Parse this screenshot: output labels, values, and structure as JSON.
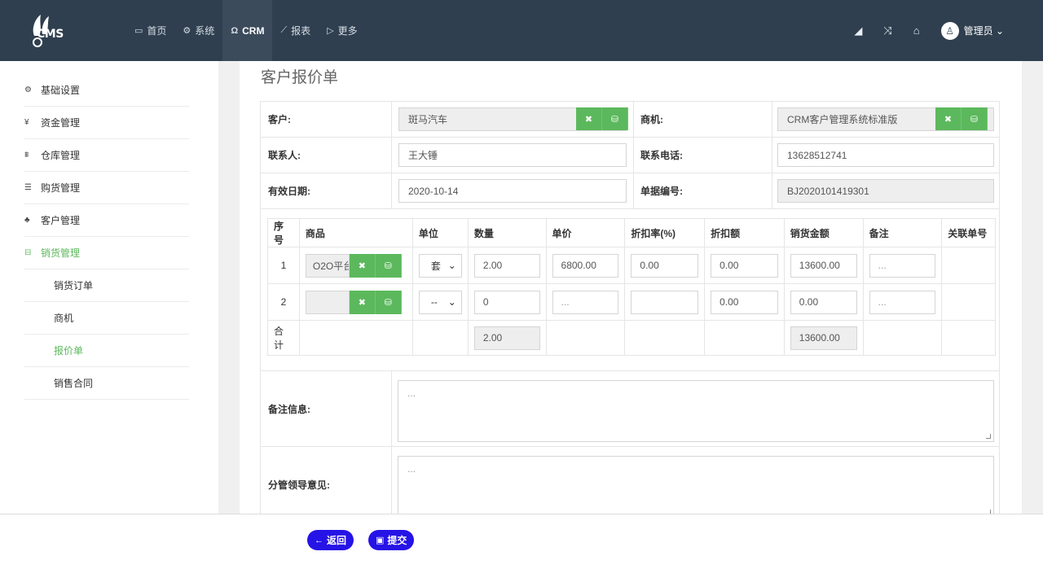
{
  "app": {
    "logo_text": "CMS"
  },
  "nav": {
    "items": [
      {
        "label": "首页",
        "icon": "monitor-icon"
      },
      {
        "label": "系统",
        "icon": "gear-icon"
      },
      {
        "label": "CRM",
        "icon": "user-icon"
      },
      {
        "label": "报表",
        "icon": "line-chart-icon"
      },
      {
        "label": "更多",
        "icon": "tag-icon"
      }
    ],
    "active": "CRM",
    "right_icons": [
      "eraser-icon",
      "shuffle-icon",
      "home-icon"
    ],
    "admin_label": "管理员"
  },
  "sidebar": {
    "items": [
      {
        "label": "基础设置",
        "icon": "cogs-icon"
      },
      {
        "label": "资金管理",
        "icon": "yen-icon"
      },
      {
        "label": "仓库管理",
        "icon": "sitemap-icon"
      },
      {
        "label": "购货管理",
        "icon": "database-icon"
      },
      {
        "label": "客户管理",
        "icon": "users-icon"
      },
      {
        "label": "销货管理",
        "icon": "car-icon"
      }
    ],
    "sub_items": [
      {
        "label": "销货订单"
      },
      {
        "label": "商机"
      },
      {
        "label": "报价单"
      },
      {
        "label": "销售合同"
      }
    ],
    "selected_sub": "报价单"
  },
  "page": {
    "title": "客户报价单"
  },
  "form": {
    "customer_label": "客户:",
    "customer_value": "斑马汽车",
    "opportunity_label": "商机:",
    "opportunity_value": "CRM客户管理系统标准版",
    "contact_label": "联系人:",
    "contact_value": "王大锤",
    "phone_label": "联系电话:",
    "phone_value": "13628512741",
    "valid_date_label": "有效日期:",
    "valid_date_value": "2020-10-14",
    "doc_no_label": "单据编号:",
    "doc_no_value": "BJ2020101419301"
  },
  "items_table": {
    "headers": [
      "序号",
      "商品",
      "单位",
      "数量",
      "单价",
      "折扣率(%)",
      "折扣额",
      "销货金额",
      "备注",
      "关联单号"
    ],
    "rows": [
      {
        "no": "1",
        "product": "O2O平台",
        "unit": "套",
        "qty": "2.00",
        "price": "6800.00",
        "discount_rate": "0.00",
        "discount_amt": "0.00",
        "amount": "13600.00",
        "note": "..."
      },
      {
        "no": "2",
        "product": "",
        "unit": "--",
        "qty": "0",
        "price": "...",
        "discount_rate": "",
        "discount_amt": "0.00",
        "amount": "0.00",
        "note": "..."
      }
    ],
    "total_label": "合计",
    "total_qty": "2.00",
    "total_amount": "13600.00"
  },
  "remarks": {
    "label": "备注信息:",
    "placeholder": "..."
  },
  "leader_opinion": {
    "label": "分管领导意见:",
    "placeholder": "..."
  },
  "footer": {
    "back_label": "返回",
    "submit_label": "提交"
  }
}
